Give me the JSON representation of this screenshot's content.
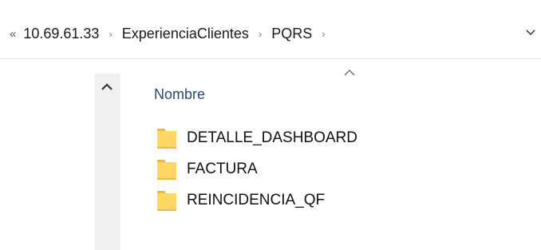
{
  "address_bar": {
    "overflow_label": "«",
    "crumbs": [
      "10.69.61.33",
      "ExperienciaClientes",
      "PQRS"
    ],
    "separator": "›",
    "dropdown_icon": "chevron-down-icon"
  },
  "navigation_pane": {
    "scroll_icon": "chevron-up-icon"
  },
  "file_list": {
    "column_header": "Nombre",
    "sort_indicator": "chevron-up-icon",
    "items": [
      {
        "name": "DETALLE_DASHBOARD",
        "icon": "folder-icon"
      },
      {
        "name": "FACTURA",
        "icon": "folder-icon"
      },
      {
        "name": "REINCIDENCIA_QF",
        "icon": "folder-icon"
      }
    ]
  },
  "colors": {
    "folder_yellow": "#ffd767",
    "folder_shadow": "#e9b944",
    "header_text": "#2b4a73",
    "scrollbar_bg": "#f0f0f0"
  }
}
